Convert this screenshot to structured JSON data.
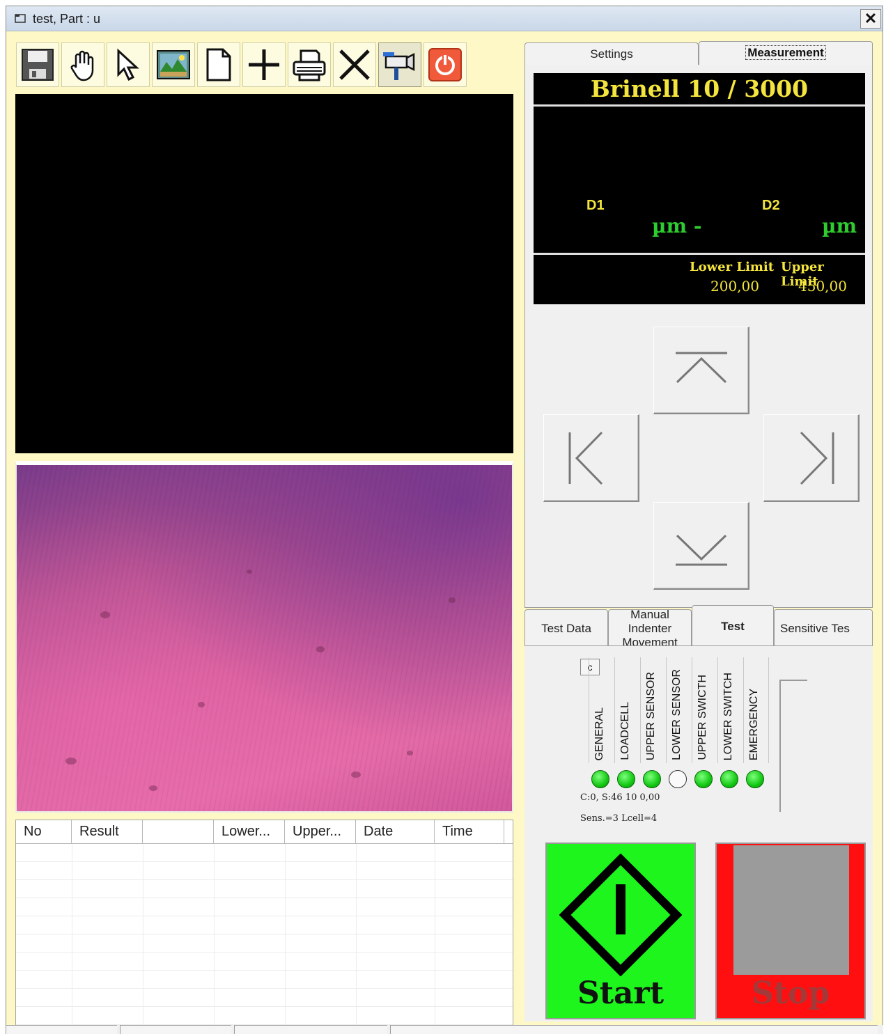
{
  "window": {
    "title": "test, Part : u",
    "close_glyph": "✕"
  },
  "toolbar": {
    "buttons": [
      {
        "icon": "save-icon"
      },
      {
        "icon": "hand-pan-icon"
      },
      {
        "icon": "pointer-icon"
      },
      {
        "icon": "image-capture-icon"
      },
      {
        "icon": "new-document-icon"
      },
      {
        "icon": "crosshair-add-icon"
      },
      {
        "icon": "print-icon"
      },
      {
        "icon": "delete-x-icon"
      },
      {
        "icon": "camera-icon"
      },
      {
        "icon": "power-icon"
      }
    ]
  },
  "results_table": {
    "columns": [
      "No",
      "Result",
      "",
      "Lower...",
      "Upper...",
      "Date",
      "Time"
    ],
    "rows": []
  },
  "right_tabs": {
    "settings": "Settings",
    "measurement": "Measurement",
    "active": "Measurement"
  },
  "measurement_display": {
    "title": "Brinell 10 / 3000",
    "d1_label": "D1",
    "d2_label": "D2",
    "d1_unit": "µm -",
    "d2_unit": "µm",
    "lower_limit_label": "Lower Limit",
    "upper_limit_label": "Upper Limit",
    "lower_limit_value": "200,00",
    "upper_limit_value": "450,00"
  },
  "movement_buttons": [
    "up-arrow-icon",
    "left-arrow-icon",
    "right-arrow-icon",
    "down-arrow-icon"
  ],
  "bottom_tabs": {
    "items": [
      "Test Data",
      "Manual Indenter Movement",
      "Test",
      "Sensitive Tes"
    ],
    "active": "Test"
  },
  "test_panel": {
    "c_button": "c",
    "sensors": [
      {
        "label": "GENERAL",
        "state": "on"
      },
      {
        "label": "LOADCELL",
        "state": "on"
      },
      {
        "label": "UPPER SENSOR",
        "state": "on"
      },
      {
        "label": "LOWER SENSOR",
        "state": "off"
      },
      {
        "label": "UPPER SWICTH",
        "state": "on"
      },
      {
        "label": "LOWER SWITCH",
        "state": "on"
      },
      {
        "label": "EMERGENCY",
        "state": "on"
      }
    ],
    "status_line_1": "C:0, S:46 10 0,00",
    "status_line_2": "Sens.=3 Lcell=4",
    "start_label": "Start",
    "stop_label": "Stop"
  },
  "colors": {
    "window_bg": "#fdf8c6",
    "display_yellow": "#f4e53e",
    "display_green": "#2ecc2e",
    "start_green": "#1df51d",
    "stop_red": "#ff0f0f",
    "led_green": "#13c813"
  }
}
